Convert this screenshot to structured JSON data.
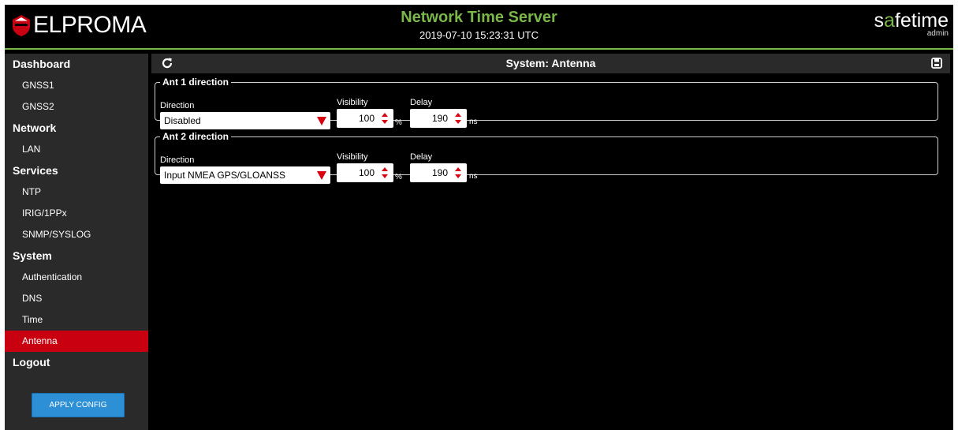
{
  "header": {
    "logo_text": "ELPROMA",
    "title": "Network Time Server",
    "datetime": "2019-07-10 15:23:31 UTC",
    "brand_prefix": "s",
    "brand_highlight": "a",
    "brand_suffix": "fetime",
    "user": "admin",
    "accent_color": "#7ab648"
  },
  "sidebar": {
    "dashboard": "Dashboard",
    "gnss1": "GNSS1",
    "gnss2": "GNSS2",
    "network": "Network",
    "lan": "LAN",
    "services": "Services",
    "ntp": "NTP",
    "irig": "IRIG/1PPx",
    "snmp": "SNMP/SYSLOG",
    "system": "System",
    "authentication": "Authentication",
    "dns": "DNS",
    "time": "Time",
    "antenna": "Antenna",
    "logout": "Logout",
    "active_item": "Antenna",
    "active_color": "#c8000f",
    "apply_button": "APPLY CONFIG"
  },
  "toolbar": {
    "refresh_icon": "refresh-icon",
    "title": "System: Antenna",
    "save_icon": "save-icon"
  },
  "antennas": [
    {
      "legend": "Ant 1 direction",
      "direction_label": "Direction",
      "direction_value": "Disabled",
      "visibility_label": "Visibility",
      "visibility_value": "100",
      "visibility_unit": "%",
      "delay_label": "Delay",
      "delay_value": "190",
      "delay_unit": "ns"
    },
    {
      "legend": "Ant 2 direction",
      "direction_label": "Direction",
      "direction_value": "Input NMEA GPS/GLOANSS",
      "visibility_label": "Visibility",
      "visibility_value": "100",
      "visibility_unit": "%",
      "delay_label": "Delay",
      "delay_value": "190",
      "delay_unit": "ns"
    }
  ]
}
